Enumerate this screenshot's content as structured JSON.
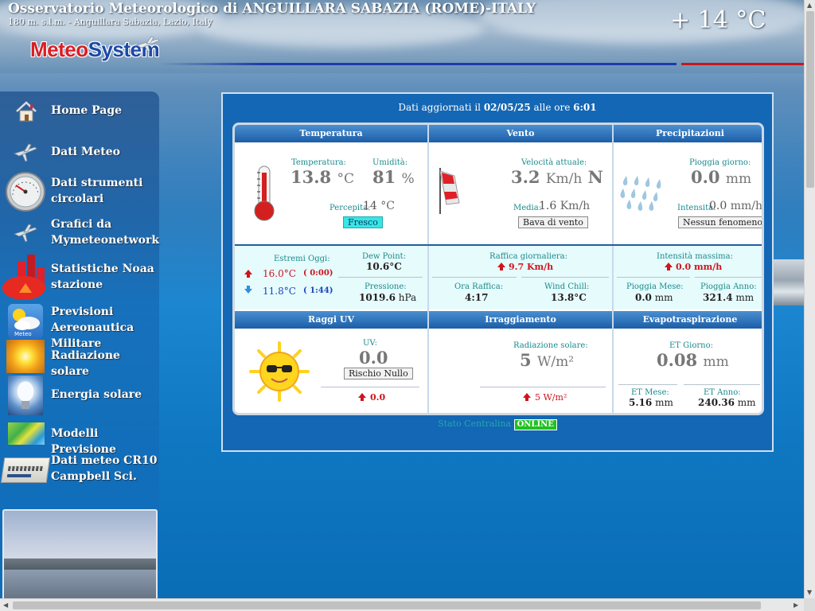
{
  "header": {
    "site_title": "Osservatorio Meteorologico di ANGUILLARA SABAZIA (ROME)-ITALY",
    "subtitle": "180 m. s.l.m. - Anguillara Sabazia, Lazio, Italy",
    "current_temp": "+ 14 °C",
    "logo_part1": "Meteo",
    "logo_part2": "System"
  },
  "sidebar": {
    "items": [
      {
        "label": "Home Page",
        "icon": "home-icon"
      },
      {
        "label": "Dati Meteo",
        "icon": "plane-icon"
      },
      {
        "label": "Dati strumenti circolari",
        "icon": "gauge-icon"
      },
      {
        "label": "Grafici da Mymeteonetwork",
        "icon": "plane-icon"
      },
      {
        "label": "Statistiche Noaa stazione",
        "icon": "bar-chart-icon"
      },
      {
        "label": "Previsioni Aereonautica Militare",
        "icon": "weather-forecast-icon"
      },
      {
        "label": "Radiazione solare",
        "icon": "sun-icon"
      },
      {
        "label": "Energia solare",
        "icon": "light-bulb-icon"
      },
      {
        "label": "Modelli Previsione",
        "icon": "map-icon"
      },
      {
        "label": "Dati meteo CR10 Campbell Sci.",
        "icon": "datalogger-icon"
      }
    ],
    "weather_forecast_badge": "Meteo"
  },
  "main": {
    "updated_prefix": "Dati aggiornati il ",
    "updated_date": "02/05/25",
    "updated_mid": " alle ore ",
    "updated_time": "6:01",
    "temperatura": {
      "header": "Temperatura",
      "temp_label": "Temperatura:",
      "temp_value": "13.8",
      "temp_unit": "°C",
      "hum_label": "Umidità:",
      "hum_value": "81",
      "hum_unit": "%",
      "perc_label": "Percepita:",
      "perc_value": "14",
      "perc_unit": "°C",
      "perc_box": "Fresco",
      "estremi_label": "Estremi Oggi:",
      "max_value": "16.0°C",
      "max_time": "( 0:00)",
      "min_value": "11.8°C",
      "min_time": "( 1:44)",
      "dew_label": "Dew Point:",
      "dew_value": "10.6°C",
      "press_label": "Pressione:",
      "press_value": "1019.6",
      "press_unit": "hPa"
    },
    "vento": {
      "header": "Vento",
      "speed_label": "Velocità attuale:",
      "speed_value": "3.2",
      "speed_unit": "Km/h",
      "speed_dir": "N",
      "media_label": "Media:",
      "media_value": "1.6",
      "media_unit": "Km/h",
      "box": "Bava di vento",
      "gust_label": "Raffica giornaliera:",
      "gust_value": "9.7 Km/h",
      "gust_time_label": "Ora Raffica:",
      "gust_time_value": "4:17",
      "chill_label": "Wind Chill:",
      "chill_value": "13.8°C"
    },
    "precipitazioni": {
      "header": "Precipitazioni",
      "day_label": "Pioggia giorno:",
      "day_value": "0.0",
      "day_unit": "mm",
      "int_label": "Intensità:",
      "int_value": "0.0",
      "int_unit": "mm/h",
      "box": "Nessun fenomeno",
      "max_label": "Intensità massima:",
      "max_value": "0.0 mm/h",
      "month_label": "Pioggia Mese:",
      "month_value": "0.0",
      "month_unit": "mm",
      "year_label": "Pioggia Anno:",
      "year_value": "321.4",
      "year_unit": "mm"
    },
    "raggi_uv": {
      "header": "Raggi UV",
      "uv_label": "UV:",
      "uv_value": "0.0",
      "box": "Rischio Nullo",
      "max_value": "0.0"
    },
    "irraggiamento": {
      "header": "Irraggiamento",
      "rad_label": "Radiazione solare:",
      "rad_value": "5",
      "rad_unit": "W/m²",
      "max_value": "5 W/m²"
    },
    "evapo": {
      "header": "Evapotraspirazione",
      "day_label": "ET Giorno:",
      "day_value": "0.08",
      "day_unit": "mm",
      "month_label": "ET Mese:",
      "month_value": "5.16",
      "month_unit": "mm",
      "year_label": "ET Anno:",
      "year_value": "240.36",
      "year_unit": "mm"
    },
    "status_label": "Stato Centralina",
    "status_value": "ONLINE"
  },
  "colors": {
    "panel_bg": "#1467b4",
    "header_grad": "#1c5ea8",
    "cyan_bg": "#e6fbfc",
    "label_teal": "#1a8a8c",
    "max_red": "#d0141c",
    "min_blue": "#1a45b8",
    "online_green": "#20c020"
  }
}
